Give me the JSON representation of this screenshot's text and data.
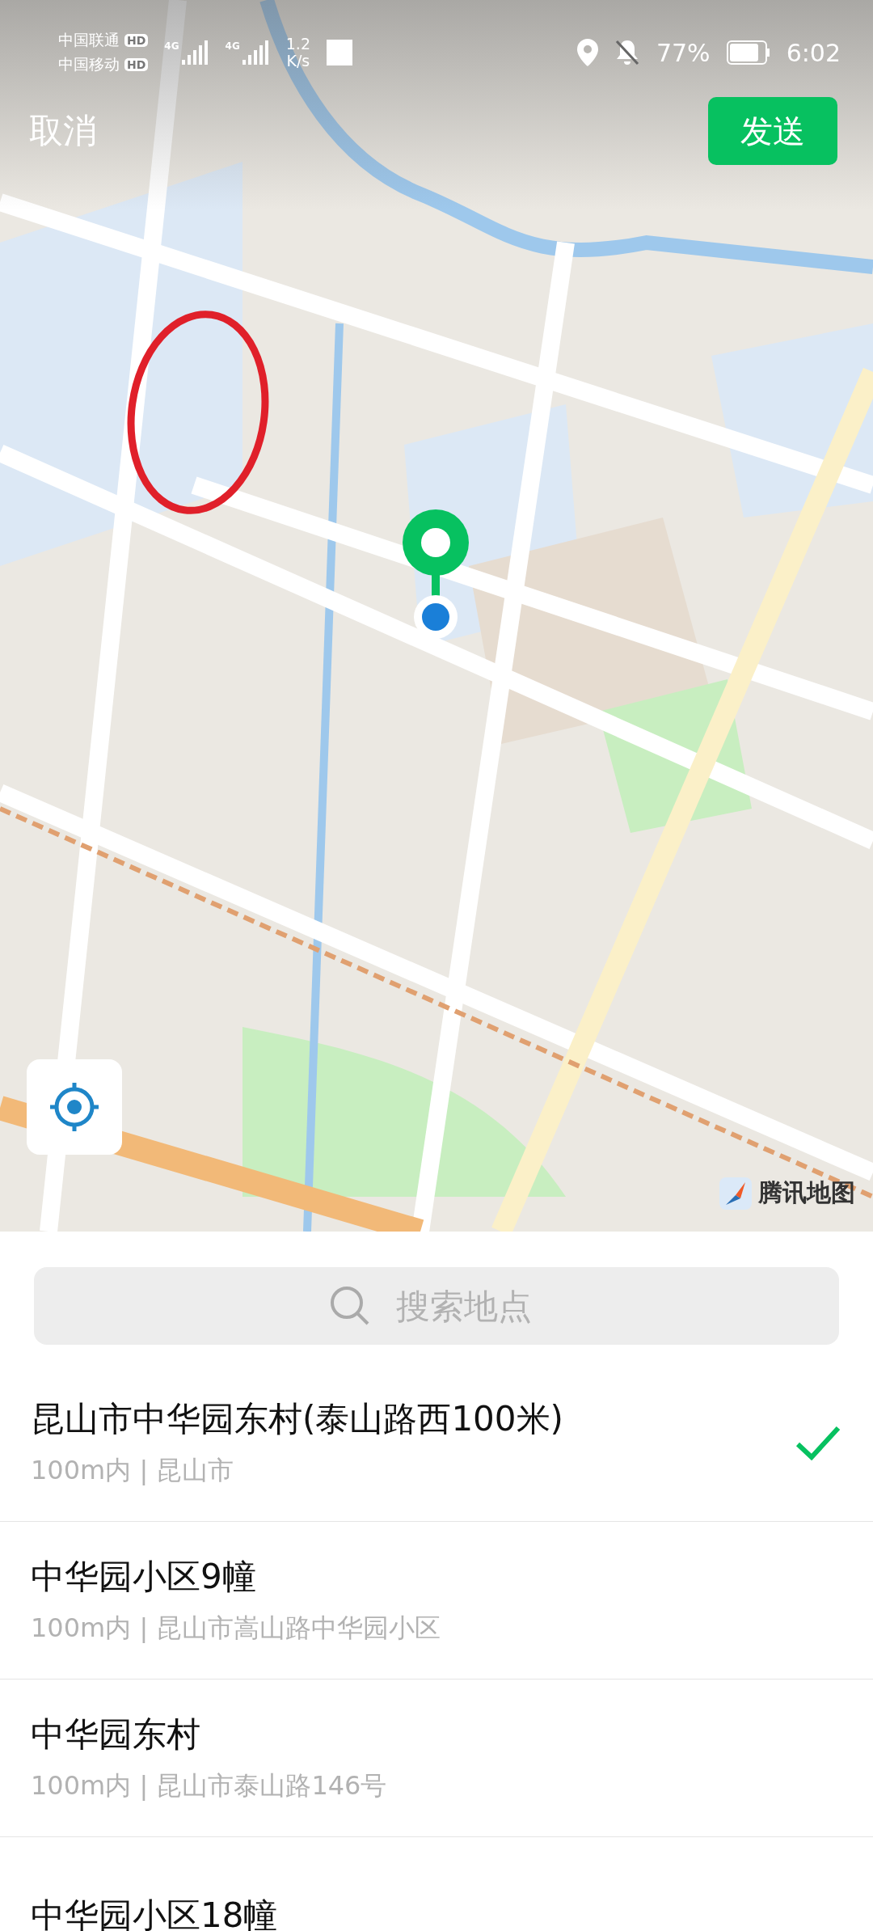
{
  "status_bar": {
    "carriers": [
      {
        "name": "中国联通",
        "badge": "HD"
      },
      {
        "name": "中国移动",
        "badge": "HD"
      }
    ],
    "network": [
      "4G",
      "4G"
    ],
    "speed": [
      "1.2",
      "K/s"
    ],
    "battery": "77%",
    "time": "6:02"
  },
  "header": {
    "cancel": "取消",
    "send": "发送"
  },
  "map": {
    "provider": "腾讯地图"
  },
  "search": {
    "placeholder": "搜索地点"
  },
  "places": [
    {
      "name": "昆山市中华园东村(泰山路西100米)",
      "detail": "100m内 | 昆山市",
      "selected": true
    },
    {
      "name": "中华园小区9幢",
      "detail": "100m内 | 昆山市嵩山路中华园小区",
      "selected": false
    },
    {
      "name": "中华园东村",
      "detail": "100m内 | 昆山市泰山路146号",
      "selected": false
    },
    {
      "name": "中华园小区18幢",
      "selected": false
    }
  ]
}
